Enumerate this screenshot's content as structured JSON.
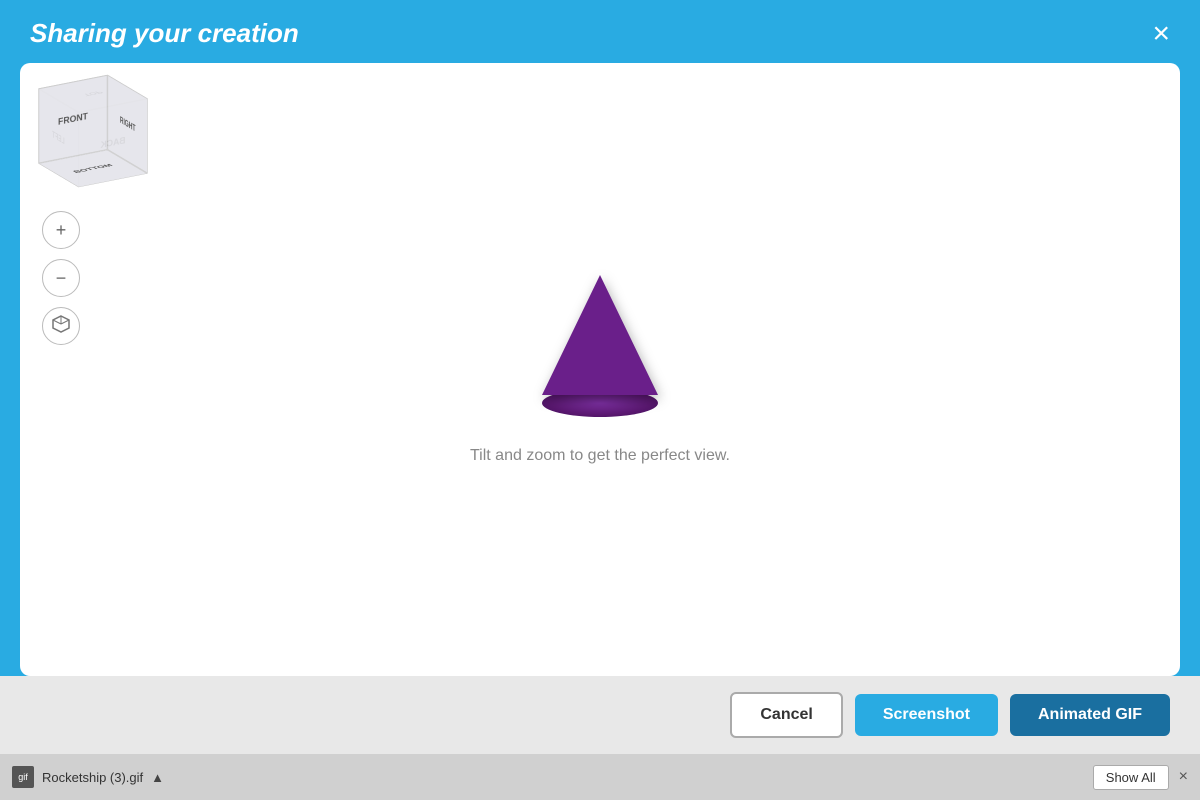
{
  "header": {
    "title": "Sharing your creation",
    "close_label": "×"
  },
  "viewport": {
    "hint_text": "Tilt and zoom to get the perfect view."
  },
  "cube": {
    "faces": {
      "front": "FRONT",
      "back": "BACK",
      "left": "LEFT",
      "right": "RIGHT",
      "top": "TOP",
      "bottom": "BOTTOM"
    }
  },
  "controls": {
    "zoom_in_icon": "+",
    "zoom_out_icon": "−",
    "reset_icon": "⬡"
  },
  "buttons": {
    "cancel_label": "Cancel",
    "screenshot_label": "Screenshot",
    "animated_gif_label": "Animated GIF"
  },
  "status_bar": {
    "file_icon_text": "gif",
    "file_name": "Rocketship (3).gif",
    "chevron": "▲",
    "show_all_label": "Show All",
    "close_label": "×"
  },
  "colors": {
    "header_bg": "#29abe2",
    "screenshot_btn": "#29abe2",
    "animated_gif_btn": "#1a6fa0"
  }
}
